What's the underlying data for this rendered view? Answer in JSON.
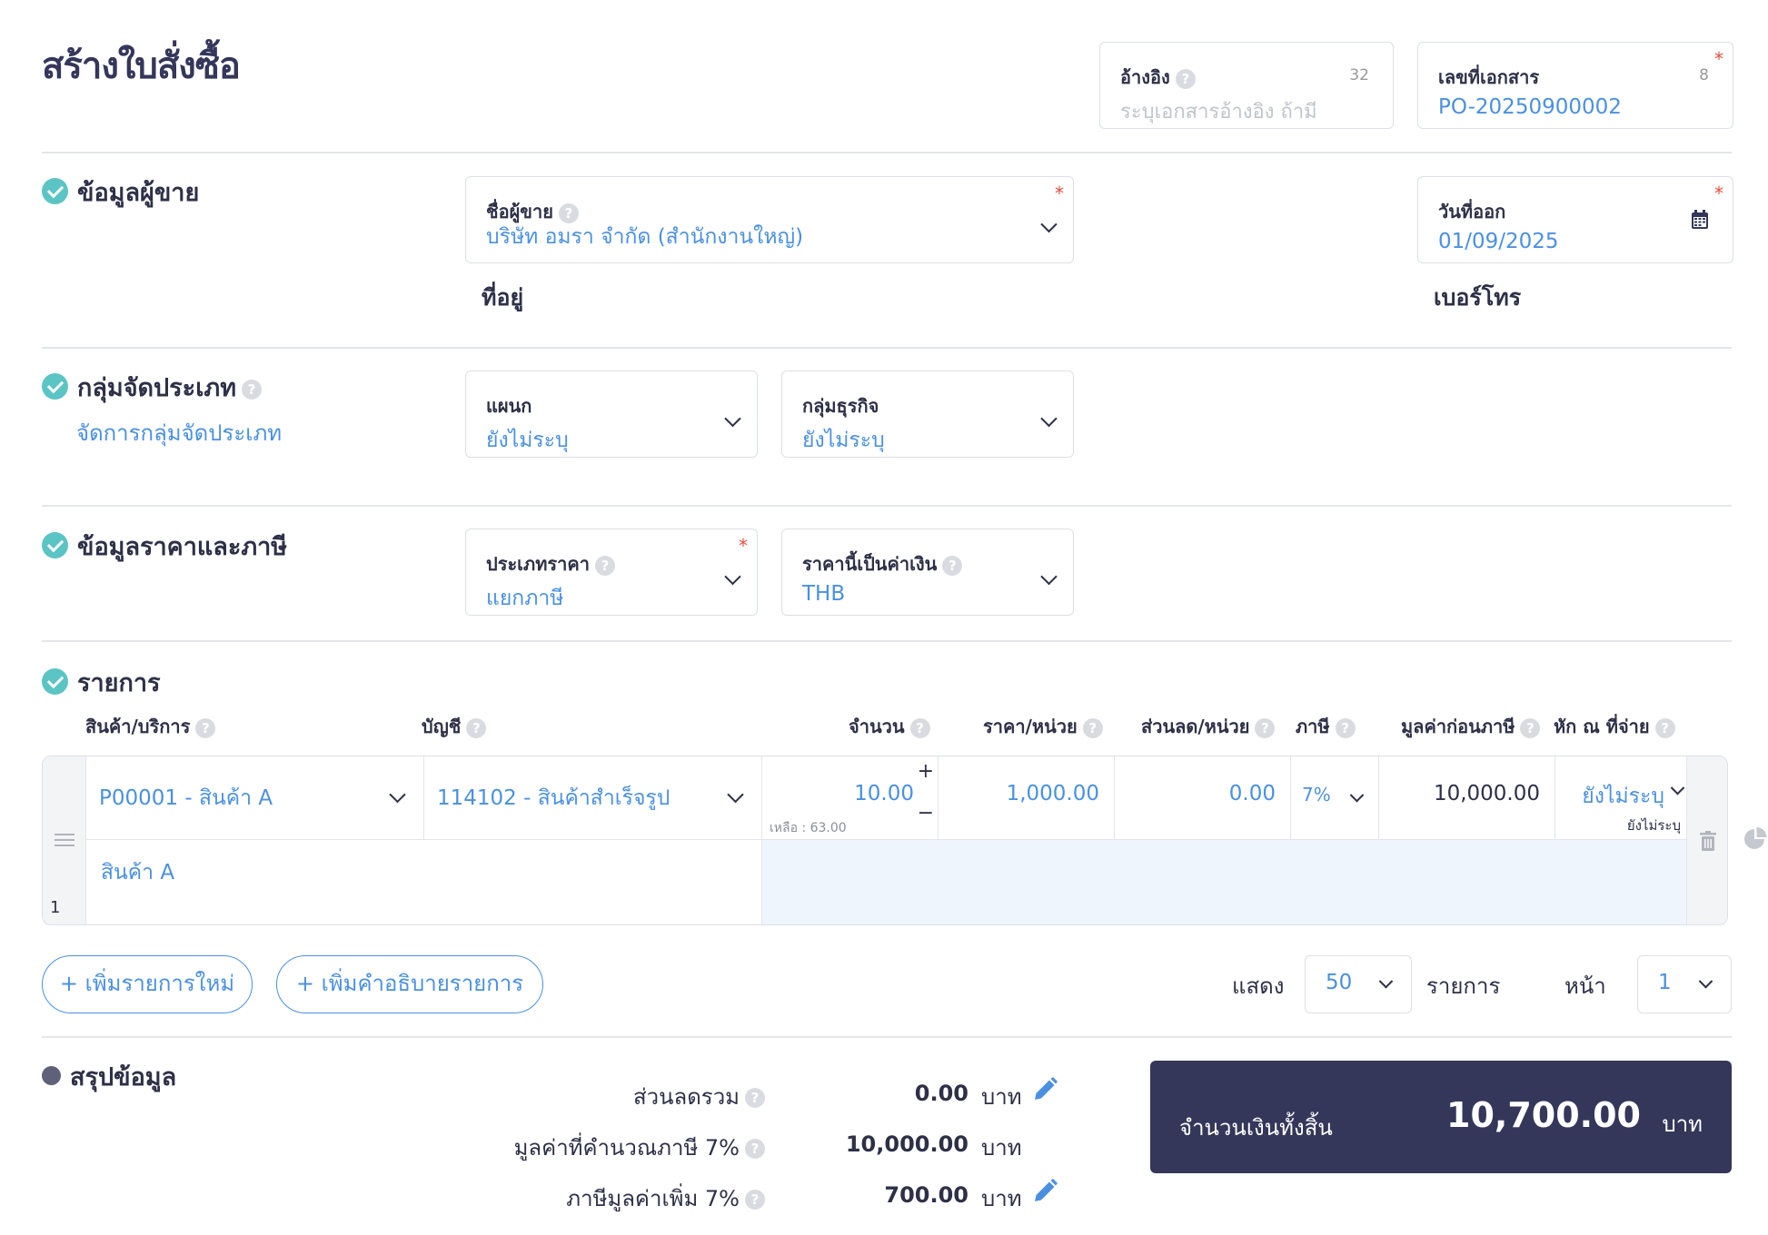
{
  "page": {
    "title": "สร้างใบสั่งซื้อ"
  },
  "reference": {
    "label": "อ้างอิง",
    "placeholder": "ระบุเอกสารอ้างอิง ถ้ามี",
    "counter": "32"
  },
  "docno": {
    "label": "เลขที่เอกสาร",
    "value": "PO-20250900002",
    "counter": "8",
    "required": "*"
  },
  "vendor": {
    "section": "ข้อมูลผู้ขาย",
    "name_label": "ชื่อผู้ขาย",
    "name_value": "บริษัท อมรา จำกัด (สำนักงานใหญ่)",
    "address_label": "ที่อยู่",
    "date_label": "วันที่ออก",
    "date_value": "01/09/2025",
    "phone_label": "เบอร์โทร"
  },
  "group": {
    "section": "กลุ่มจัดประเภท",
    "manage_link": "จัดการกลุ่มจัดประเภท",
    "dept_label": "แผนก",
    "dept_value": "ยังไม่ระบุ",
    "biz_label": "กลุ่มธุรกิจ",
    "biz_value": "ยังไม่ระบุ"
  },
  "pricing": {
    "section": "ข้อมูลราคาและภาษี",
    "type_label": "ประเภทราคา",
    "type_value": "แยกภาษี",
    "currency_label": "ราคานี้เป็นค่าเงิน",
    "currency_value": "THB"
  },
  "items": {
    "section": "รายการ",
    "headers": {
      "product": "สินค้า/บริการ",
      "account": "บัญชี",
      "qty": "จำนวน",
      "price": "ราคา/หน่วย",
      "discount": "ส่วนลด/หน่วย",
      "tax": "ภาษี",
      "pretax": "มูลค่าก่อนภาษี",
      "wht": "หัก ณ ที่จ่าย"
    },
    "rows": [
      {
        "no": "1",
        "product": "P00001 - สินค้า A",
        "account": "114102 - สินค้าสำเร็จรูป",
        "qty": "10.00",
        "remaining": "เหลือ : 63.00",
        "price": "1,000.00",
        "discount": "0.00",
        "tax": "7%",
        "pretax": "10,000.00",
        "wht": "ยังไม่ระบุ",
        "wht_sub": "ยังไม่ระบุ",
        "description": "สินค้า A"
      }
    ],
    "add_item": "+ เพิ่มรายการใหม่",
    "add_desc": "+ เพิ่มคำอธิบายรายการ",
    "show_label": "แสดง",
    "show_value": "50",
    "items_label": "รายการ",
    "page_label": "หน้า",
    "page_value": "1"
  },
  "summary": {
    "section": "สรุปข้อมูล",
    "discount_label": "ส่วนลดรวม",
    "discount_value": "0.00",
    "taxable_label": "มูลค่าที่คำนวณภาษี 7%",
    "taxable_value": "10,000.00",
    "vat_label": "ภาษีมูลค่าเพิ่ม 7%",
    "vat_value": "700.00",
    "unit": "บาท",
    "total_label": "จำนวนเงินทั้งสิ้น",
    "total_value": "10,700.00",
    "total_unit": "บาท"
  },
  "colors": {
    "accent": "#4a90e2",
    "dark": "#34375a",
    "check": "#5bc4c4",
    "required": "#e74c3c",
    "row_highlight": "#eef5fd"
  }
}
